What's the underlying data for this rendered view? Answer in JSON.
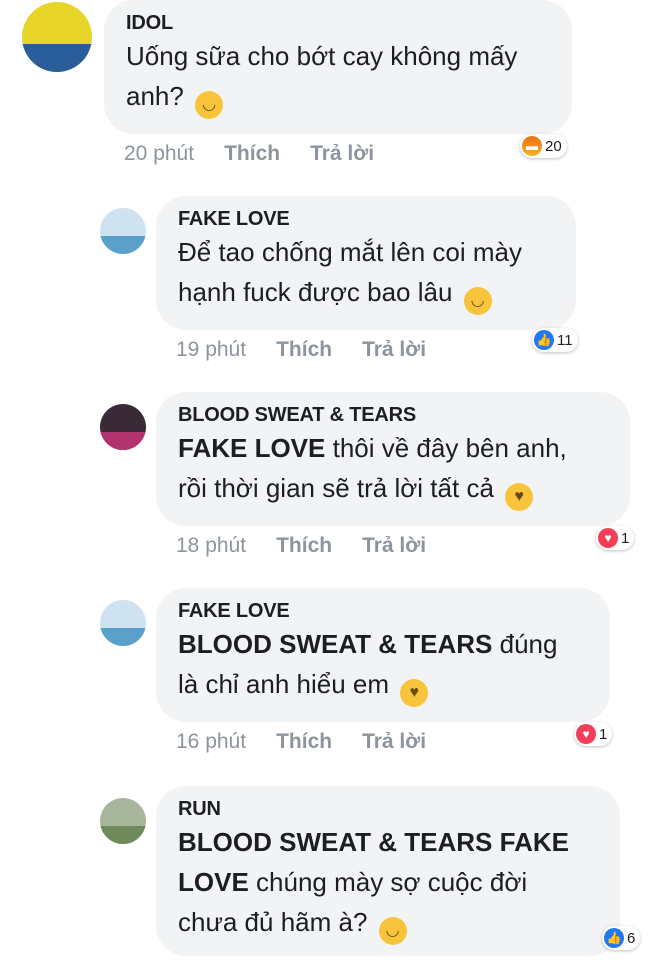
{
  "comments": [
    {
      "author": "IDOL",
      "avatar_color": "#e8d52a",
      "lines": [
        "Uống sữa cho bớt cay không mấy",
        "anh?"
      ],
      "emoji": "relieved-face",
      "time": "20 phút",
      "like_label": "Thích",
      "reply_label": "Trả lời",
      "reaction": {
        "type": "angry",
        "count": "20"
      }
    },
    {
      "author": "FAKE LOVE",
      "avatar_color": "#5aa0c8",
      "lines": [
        "Để tao chống mắt lên coi mày",
        "hạnh fuck được bao lâu"
      ],
      "emoji": "smirking-face",
      "time": "19 phút",
      "like_label": "Thích",
      "reply_label": "Trả lời",
      "reaction": {
        "type": "like",
        "count": "11"
      }
    },
    {
      "author": "BLOOD SWEAT & TEARS",
      "avatar_color": "#3a2a36",
      "tag": "FAKE LOVE",
      "lines": [
        "thôi về đây bên anh,",
        "rồi thời gian sẽ trả lời tất cả"
      ],
      "emoji": "kissing-face",
      "time": "18 phút",
      "like_label": "Thích",
      "reply_label": "Trả lời",
      "reaction": {
        "type": "love",
        "count": "1"
      }
    },
    {
      "author": "FAKE LOVE",
      "avatar_color": "#5aa0c8",
      "tag": "BLOOD SWEAT & TEARS",
      "lines": [
        "đúng",
        "là chỉ anh hiểu em"
      ],
      "emoji": "kissing-face",
      "time": "16 phút",
      "like_label": "Thích",
      "reply_label": "Trả lời",
      "reaction": {
        "type": "love",
        "count": "1"
      }
    },
    {
      "author": "RUN",
      "avatar_color": "#6e8a5a",
      "tag": "BLOOD SWEAT & TEARS FAKE",
      "tag2": "LOVE",
      "lines": [
        "chúng mày sợ cuộc đời",
        "chưa đủ hãm à?"
      ],
      "emoji": "slightly-smiling-face",
      "reaction": {
        "type": "like",
        "count": "6"
      }
    }
  ]
}
